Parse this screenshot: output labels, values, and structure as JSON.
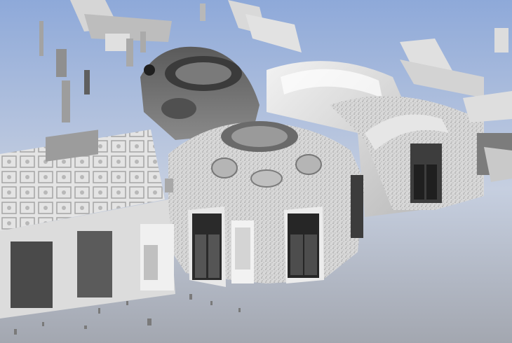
{
  "scene": {
    "subject": "point-cloud-scan",
    "colors": {
      "sky_top": "#8ea9d9",
      "sky_bottom": "#d9dde6",
      "floor_top": "#a9adb6",
      "floor_bottom": "#9da1aa",
      "scan_light": "#eeeeee",
      "scan_mid": "#bdbdbd",
      "scan_dark": "#3a3a3a",
      "window_glass": "#2b2b2b"
    }
  }
}
